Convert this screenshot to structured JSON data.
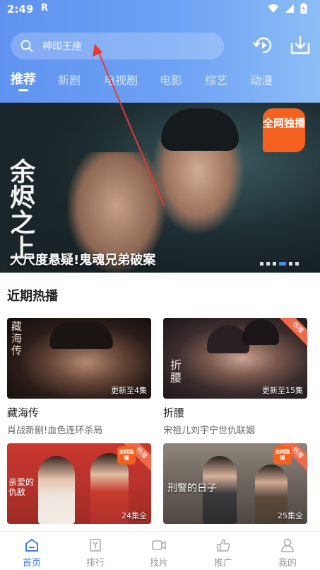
{
  "status_bar": {
    "time": "2:49",
    "indicator": "R",
    "icons": [
      "wifi-icon",
      "signal-icon",
      "battery-icon"
    ]
  },
  "search": {
    "placeholder": "神印王座"
  },
  "header_buttons": [
    "history-icon",
    "download-icon"
  ],
  "tabs": [
    {
      "label": "推荐",
      "active": true
    },
    {
      "label": "新剧"
    },
    {
      "label": "电视剧"
    },
    {
      "label": "电影"
    },
    {
      "label": "综艺"
    },
    {
      "label": "动漫"
    }
  ],
  "banner": {
    "title": "大尺度悬疑!鬼魂兄弟破案",
    "logo_text": "余烬之上",
    "badge": "全网独播",
    "dots": 6,
    "active_dot": 4
  },
  "section": {
    "title": "近期热播"
  },
  "cards": [
    {
      "title": "藏海传",
      "desc": "肖战新剧!血色连环杀局",
      "update": "更新至4集",
      "poster_text": "藏海传",
      "tag": ""
    },
    {
      "title": "折腰",
      "desc": "宋祖儿刘宇宁世仇联姻",
      "update": "更新至15集",
      "poster_text": "折腰",
      "tag": "热播"
    },
    {
      "title": "",
      "desc": "",
      "update": "24集全",
      "poster_text": "亲爱的仇敌",
      "tag": "热播",
      "badge": "全网独播"
    },
    {
      "title": "",
      "desc": "",
      "update": "25集全",
      "poster_text": "刑警的日子",
      "tag": "热播",
      "badge": "全网独播"
    }
  ],
  "bottom_nav": [
    {
      "label": "首页",
      "icon": "home-icon",
      "active": true
    },
    {
      "label": "排行",
      "icon": "ranking-icon"
    },
    {
      "label": "找片",
      "icon": "video-icon"
    },
    {
      "label": "推广",
      "icon": "thumbs-up-icon"
    },
    {
      "label": "我的",
      "icon": "profile-icon"
    }
  ],
  "colors": {
    "accent": "#3e7ef0",
    "header_start": "#5f93f0",
    "header_end": "#8cbdf6",
    "badge": "#f5611e",
    "annotation": "#e53935"
  }
}
